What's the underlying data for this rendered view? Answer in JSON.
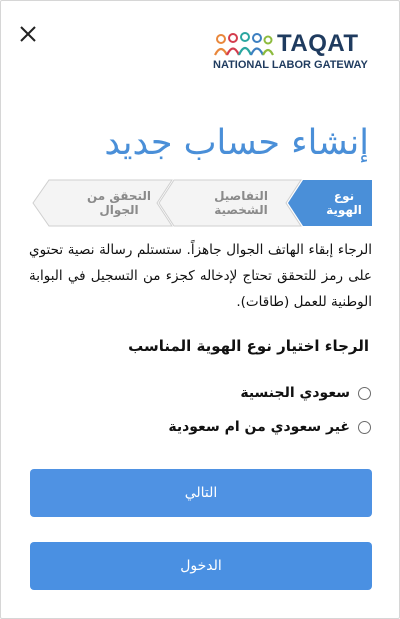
{
  "logo": {
    "brand": "TAQAT",
    "tagline": "NATIONAL LABOR GATEWAY"
  },
  "page": {
    "title": "إنشاء حساب جديد"
  },
  "stepper": {
    "steps": [
      {
        "label": "نوع الهوية",
        "active": true
      },
      {
        "label": "التفاصيل الشخصية",
        "active": false
      },
      {
        "label": "التحقق من الجوال",
        "active": false
      }
    ],
    "active_color": "#4a8fd8",
    "inactive_color": "#f2f2f2"
  },
  "instructions": "الرجاء إبقاء الهاتف الجوال جاهزاً. ستستلم رسالة نصية تحتوي على رمز للتحقق تحتاج لإدخاله كجزء من التسجيل في البوابة الوطنية للعمل (طاقات).",
  "form": {
    "question": "الرجاء اختيار نوع الهوية المناسب",
    "options": [
      {
        "label": "سعودي الجنسية",
        "selected": false
      },
      {
        "label": "غير سعودي من ام سعودية",
        "selected": false
      }
    ]
  },
  "buttons": {
    "next": "التالي",
    "login": "الدخول"
  },
  "colors": {
    "accent": "#4a90e2",
    "title": "#4a8fd8",
    "brand_dark": "#1f3b5f"
  },
  "icons": {
    "close": "close-icon",
    "logo": "people-logo-icon"
  }
}
